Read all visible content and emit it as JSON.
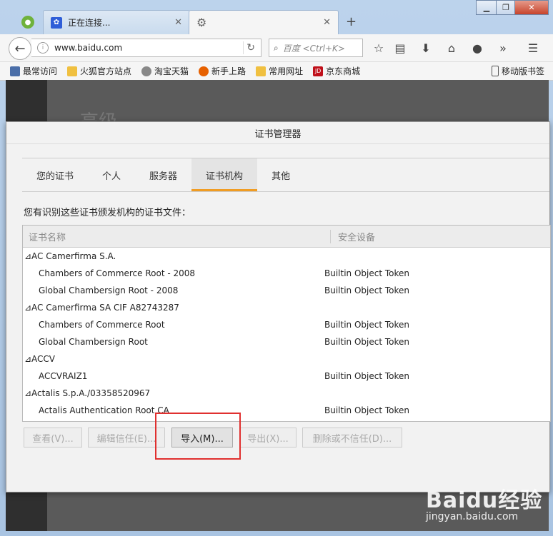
{
  "browser": {
    "tabs": [
      {
        "label": "正在连接...",
        "active": false
      },
      {
        "label": "",
        "active": true
      }
    ],
    "url": "www.baidu.com",
    "search_placeholder": "百度 <Ctrl+K>"
  },
  "bookmarks": [
    {
      "label": "最常访问",
      "icon": "bookmarks-icon",
      "color": "#4a6ea8"
    },
    {
      "label": "火狐官方站点",
      "icon": "folder-icon",
      "color": "#f0c040"
    },
    {
      "label": "淘宝天猫",
      "icon": "globe-icon",
      "color": "#888888"
    },
    {
      "label": "新手上路",
      "icon": "firefox-icon",
      "color": "#e66000"
    },
    {
      "label": "常用网址",
      "icon": "folder-icon",
      "color": "#f0c040"
    },
    {
      "label": "京东商城",
      "icon": "jd-icon",
      "color": "#c0101a"
    }
  ],
  "mobile_bookmarks": "移动版书签",
  "background": {
    "heading": "高级"
  },
  "dialog": {
    "title": "证书管理器",
    "tabs": [
      "您的证书",
      "个人",
      "服务器",
      "证书机构",
      "其他"
    ],
    "active_tab": "证书机构",
    "description": "您有识别这些证书颁发机构的证书文件：",
    "columns": {
      "name": "证书名称",
      "device": "安全设备"
    },
    "rows": [
      {
        "name": "⊿AC Camerfirma S.A.",
        "device": "",
        "group": true
      },
      {
        "name": "Chambers of Commerce Root - 2008",
        "device": "Builtin Object Token",
        "group": false
      },
      {
        "name": "Global Chambersign Root - 2008",
        "device": "Builtin Object Token",
        "group": false
      },
      {
        "name": "⊿AC Camerfirma SA CIF A82743287",
        "device": "",
        "group": true
      },
      {
        "name": "Chambers of Commerce Root",
        "device": "Builtin Object Token",
        "group": false
      },
      {
        "name": "Global Chambersign Root",
        "device": "Builtin Object Token",
        "group": false
      },
      {
        "name": "⊿ACCV",
        "device": "",
        "group": true
      },
      {
        "name": "ACCVRAIZ1",
        "device": "Builtin Object Token",
        "group": false
      },
      {
        "name": "⊿Actalis S.p.A./03358520967",
        "device": "",
        "group": true
      },
      {
        "name": "Actalis Authentication Root CA",
        "device": "Builtin Object Token",
        "group": false
      }
    ],
    "buttons": {
      "view": "查看(V)...",
      "edit_trust": "编辑信任(E)...",
      "import": "导入(M)...",
      "export": "导出(X)...",
      "delete": "删除或不信任(D)..."
    }
  },
  "watermark": {
    "logo": "Baidu经验",
    "url": "jingyan.baidu.com"
  },
  "colors": {
    "accent": "#f09c23",
    "highlight": "#e0302f"
  }
}
